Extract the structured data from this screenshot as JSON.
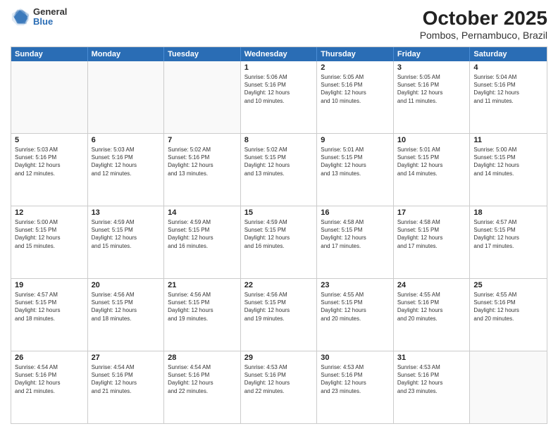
{
  "logo": {
    "general": "General",
    "blue": "Blue"
  },
  "title": "October 2025",
  "subtitle": "Pombos, Pernambuco, Brazil",
  "days": [
    "Sunday",
    "Monday",
    "Tuesday",
    "Wednesday",
    "Thursday",
    "Friday",
    "Saturday"
  ],
  "rows": [
    [
      {
        "day": "",
        "info": ""
      },
      {
        "day": "",
        "info": ""
      },
      {
        "day": "",
        "info": ""
      },
      {
        "day": "1",
        "info": "Sunrise: 5:06 AM\nSunset: 5:16 PM\nDaylight: 12 hours\nand 10 minutes."
      },
      {
        "day": "2",
        "info": "Sunrise: 5:05 AM\nSunset: 5:16 PM\nDaylight: 12 hours\nand 10 minutes."
      },
      {
        "day": "3",
        "info": "Sunrise: 5:05 AM\nSunset: 5:16 PM\nDaylight: 12 hours\nand 11 minutes."
      },
      {
        "day": "4",
        "info": "Sunrise: 5:04 AM\nSunset: 5:16 PM\nDaylight: 12 hours\nand 11 minutes."
      }
    ],
    [
      {
        "day": "5",
        "info": "Sunrise: 5:03 AM\nSunset: 5:16 PM\nDaylight: 12 hours\nand 12 minutes."
      },
      {
        "day": "6",
        "info": "Sunrise: 5:03 AM\nSunset: 5:16 PM\nDaylight: 12 hours\nand 12 minutes."
      },
      {
        "day": "7",
        "info": "Sunrise: 5:02 AM\nSunset: 5:16 PM\nDaylight: 12 hours\nand 13 minutes."
      },
      {
        "day": "8",
        "info": "Sunrise: 5:02 AM\nSunset: 5:15 PM\nDaylight: 12 hours\nand 13 minutes."
      },
      {
        "day": "9",
        "info": "Sunrise: 5:01 AM\nSunset: 5:15 PM\nDaylight: 12 hours\nand 13 minutes."
      },
      {
        "day": "10",
        "info": "Sunrise: 5:01 AM\nSunset: 5:15 PM\nDaylight: 12 hours\nand 14 minutes."
      },
      {
        "day": "11",
        "info": "Sunrise: 5:00 AM\nSunset: 5:15 PM\nDaylight: 12 hours\nand 14 minutes."
      }
    ],
    [
      {
        "day": "12",
        "info": "Sunrise: 5:00 AM\nSunset: 5:15 PM\nDaylight: 12 hours\nand 15 minutes."
      },
      {
        "day": "13",
        "info": "Sunrise: 4:59 AM\nSunset: 5:15 PM\nDaylight: 12 hours\nand 15 minutes."
      },
      {
        "day": "14",
        "info": "Sunrise: 4:59 AM\nSunset: 5:15 PM\nDaylight: 12 hours\nand 16 minutes."
      },
      {
        "day": "15",
        "info": "Sunrise: 4:59 AM\nSunset: 5:15 PM\nDaylight: 12 hours\nand 16 minutes."
      },
      {
        "day": "16",
        "info": "Sunrise: 4:58 AM\nSunset: 5:15 PM\nDaylight: 12 hours\nand 17 minutes."
      },
      {
        "day": "17",
        "info": "Sunrise: 4:58 AM\nSunset: 5:15 PM\nDaylight: 12 hours\nand 17 minutes."
      },
      {
        "day": "18",
        "info": "Sunrise: 4:57 AM\nSunset: 5:15 PM\nDaylight: 12 hours\nand 17 minutes."
      }
    ],
    [
      {
        "day": "19",
        "info": "Sunrise: 4:57 AM\nSunset: 5:15 PM\nDaylight: 12 hours\nand 18 minutes."
      },
      {
        "day": "20",
        "info": "Sunrise: 4:56 AM\nSunset: 5:15 PM\nDaylight: 12 hours\nand 18 minutes."
      },
      {
        "day": "21",
        "info": "Sunrise: 4:56 AM\nSunset: 5:15 PM\nDaylight: 12 hours\nand 19 minutes."
      },
      {
        "day": "22",
        "info": "Sunrise: 4:56 AM\nSunset: 5:15 PM\nDaylight: 12 hours\nand 19 minutes."
      },
      {
        "day": "23",
        "info": "Sunrise: 4:55 AM\nSunset: 5:15 PM\nDaylight: 12 hours\nand 20 minutes."
      },
      {
        "day": "24",
        "info": "Sunrise: 4:55 AM\nSunset: 5:16 PM\nDaylight: 12 hours\nand 20 minutes."
      },
      {
        "day": "25",
        "info": "Sunrise: 4:55 AM\nSunset: 5:16 PM\nDaylight: 12 hours\nand 20 minutes."
      }
    ],
    [
      {
        "day": "26",
        "info": "Sunrise: 4:54 AM\nSunset: 5:16 PM\nDaylight: 12 hours\nand 21 minutes."
      },
      {
        "day": "27",
        "info": "Sunrise: 4:54 AM\nSunset: 5:16 PM\nDaylight: 12 hours\nand 21 minutes."
      },
      {
        "day": "28",
        "info": "Sunrise: 4:54 AM\nSunset: 5:16 PM\nDaylight: 12 hours\nand 22 minutes."
      },
      {
        "day": "29",
        "info": "Sunrise: 4:53 AM\nSunset: 5:16 PM\nDaylight: 12 hours\nand 22 minutes."
      },
      {
        "day": "30",
        "info": "Sunrise: 4:53 AM\nSunset: 5:16 PM\nDaylight: 12 hours\nand 23 minutes."
      },
      {
        "day": "31",
        "info": "Sunrise: 4:53 AM\nSunset: 5:16 PM\nDaylight: 12 hours\nand 23 minutes."
      },
      {
        "day": "",
        "info": ""
      }
    ]
  ]
}
